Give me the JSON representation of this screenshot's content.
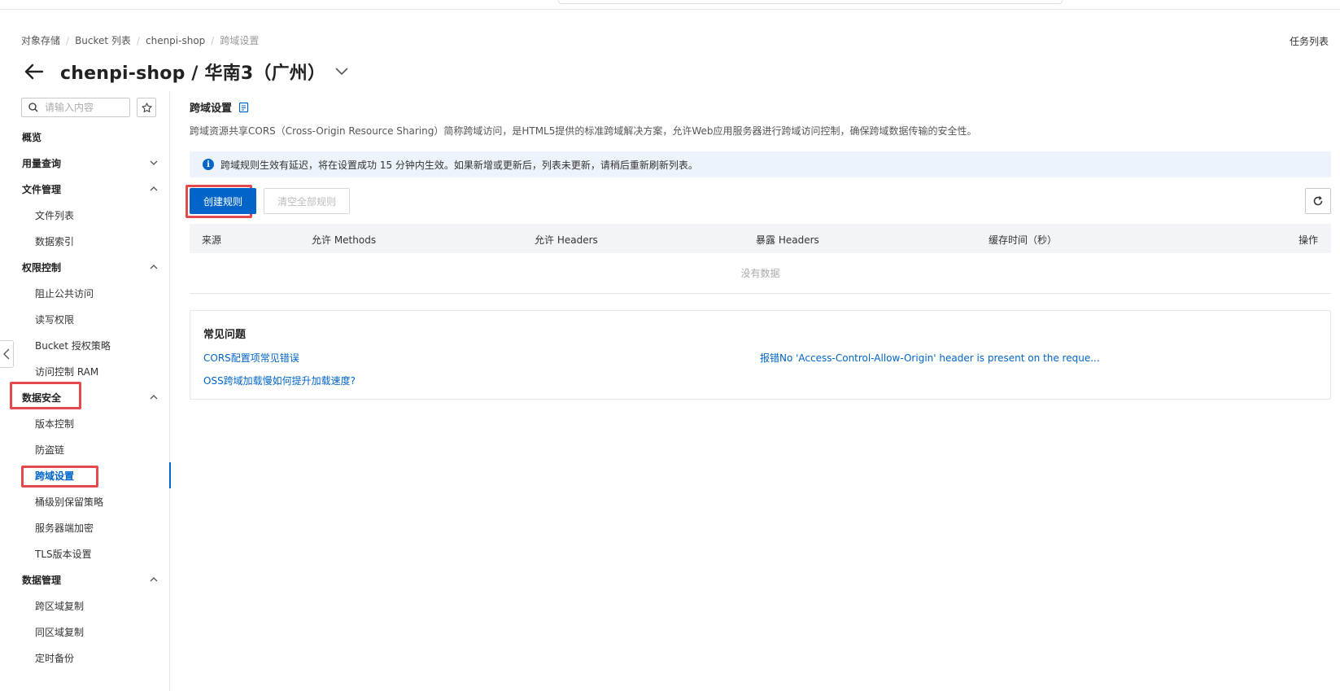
{
  "breadcrumb": [
    "对象存储",
    "Bucket 列表",
    "chenpi-shop",
    "跨域设置"
  ],
  "header": {
    "title": "chenpi-shop / 华南3（广州）",
    "task_list": "任务列表"
  },
  "sidebar": {
    "search_placeholder": "请输入内容",
    "items": [
      {
        "label": "概览"
      },
      {
        "label": "用量查询"
      },
      {
        "label": "文件管理"
      },
      {
        "label": "文件列表"
      },
      {
        "label": "数据索引"
      },
      {
        "label": "权限控制"
      },
      {
        "label": "阻止公共访问"
      },
      {
        "label": "读写权限"
      },
      {
        "label": "Bucket 授权策略"
      },
      {
        "label": "访问控制 RAM"
      },
      {
        "label": "数据安全"
      },
      {
        "label": "版本控制"
      },
      {
        "label": "防盗链"
      },
      {
        "label": "跨域设置"
      },
      {
        "label": "桶级别保留策略"
      },
      {
        "label": "服务器端加密"
      },
      {
        "label": "TLS版本设置"
      },
      {
        "label": "数据管理"
      },
      {
        "label": "跨区域复制"
      },
      {
        "label": "同区域复制"
      },
      {
        "label": "定时备份"
      }
    ]
  },
  "main": {
    "section_title": "跨域设置",
    "description": "跨域资源共享CORS（Cross-Origin Resource Sharing）简称跨域访问，是HTML5提供的标准跨域解决方案，允许Web应用服务器进行跨域访问控制，确保跨域数据传输的安全性。",
    "notice": "跨域规则生效有延迟，将在设置成功 15 分钟内生效。如果新增或更新后，列表未更新，请稍后重新刷新列表。",
    "create_button": "创建规则",
    "clear_button": "清空全部规则",
    "table": {
      "columns": [
        "来源",
        "允许 Methods",
        "允许 Headers",
        "暴露 Headers",
        "缓存时间（秒）",
        "操作"
      ],
      "empty_text": "没有数据"
    },
    "faq": {
      "title": "常见问题",
      "links": [
        "CORS配置项常见错误",
        "报错No 'Access-Control-Allow-Origin' header is present on the reque...",
        "OSS跨域加载慢如何提升加载速度?"
      ]
    }
  },
  "colors": {
    "primary": "#0064c8",
    "highlight": "#e5484d",
    "notice_bg": "#edf3fa",
    "table_header_bg": "#f2f4f7"
  }
}
